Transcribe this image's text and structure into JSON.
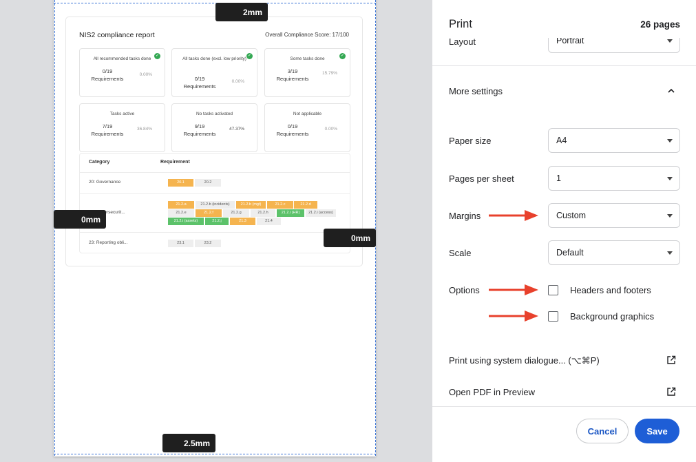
{
  "preview": {
    "margins": {
      "top": "2mm",
      "left": "0mm",
      "right": "0mm",
      "bottom": "2.5mm"
    },
    "report": {
      "title": "NIS2 compliance report",
      "score": "Overall Compliance Score:  17/100",
      "cards": [
        {
          "title": "All recommended tasks done",
          "value": "0/19",
          "unit": "Requirements",
          "percent": "0.00%",
          "check": true
        },
        {
          "title": "All tasks done (excl. low priority)",
          "value": "0/19",
          "unit": "Requirements",
          "percent": "0.00%",
          "check": true
        },
        {
          "title": "Some tasks done",
          "value": "3/19",
          "unit": "Requirements",
          "percent": "15.79%",
          "check": true
        },
        {
          "title": "Tasks active",
          "value": "7/19",
          "unit": "Requirements",
          "percent": "36.84%",
          "check": false
        },
        {
          "title": "No tasks activated",
          "value": "9/19",
          "unit": "Requirements",
          "percent": "47.37%",
          "check": false
        },
        {
          "title": "Not applicable",
          "value": "0/19",
          "unit": "Requirements",
          "percent": "0.00%",
          "check": false
        }
      ],
      "table": {
        "col_category": "Category",
        "col_requirement": "Requirement",
        "rows": [
          {
            "category": "20: Governance",
            "tags": [
              {
                "t": "20.1",
                "s": "o"
              },
              {
                "t": "20.2",
                "s": "n"
              }
            ]
          },
          {
            "category": "21: Cybersecurit...",
            "tags": [
              {
                "t": "21.2.a",
                "s": "o"
              },
              {
                "t": "21.2.b (incidents)",
                "s": "n"
              },
              {
                "t": "21.2.b (mgt)",
                "s": "o"
              },
              {
                "t": "21.2.c",
                "s": "o"
              },
              {
                "t": "21.2.d",
                "s": "o"
              },
              {
                "t": "21.2.e",
                "s": "n"
              },
              {
                "t": "21.2.f",
                "s": "o"
              },
              {
                "t": "21.2.g",
                "s": "n"
              },
              {
                "t": "21.2.h",
                "s": "n"
              },
              {
                "t": "21.2.i (HR)",
                "s": "g"
              },
              {
                "t": "21.2.i (access)",
                "s": "n"
              },
              {
                "t": "21.2.i (assets)",
                "s": "g"
              },
              {
                "t": "21.2.j",
                "s": "g"
              },
              {
                "t": "21.3",
                "s": "o"
              },
              {
                "t": "21.4",
                "s": "n"
              }
            ]
          },
          {
            "category": "23: Reporting obli...",
            "tags": [
              {
                "t": "23.1",
                "s": "n"
              },
              {
                "t": "23.2",
                "s": "n"
              }
            ]
          }
        ]
      }
    }
  },
  "panel": {
    "title": "Print",
    "pages": "26 pages",
    "layout": {
      "label": "Layout",
      "value": "Portrait"
    },
    "more_settings": "More settings",
    "paper_size": {
      "label": "Paper size",
      "value": "A4"
    },
    "pages_per_sheet": {
      "label": "Pages per sheet",
      "value": "1"
    },
    "margins": {
      "label": "Margins",
      "value": "Custom"
    },
    "scale": {
      "label": "Scale",
      "value": "Default"
    },
    "options": {
      "label": "Options",
      "headers_footers": "Headers and footers",
      "background_graphics": "Background graphics"
    },
    "system_dialog": "Print using system dialogue... (⌥⌘P)",
    "open_pdf": "Open PDF in Preview",
    "cancel": "Cancel",
    "save": "Save"
  },
  "colors": {
    "accent": "#1e5ed6",
    "arrow": "#e8412c",
    "margin_line": "#3b74d6",
    "tag_orange": "#f5b44f",
    "tag_green": "#5cc26a",
    "check_green": "#34a853"
  },
  "icons": [
    "chevron-up-icon",
    "caret-down-icon",
    "external-link-icon",
    "arrow-icon",
    "check-icon"
  ]
}
